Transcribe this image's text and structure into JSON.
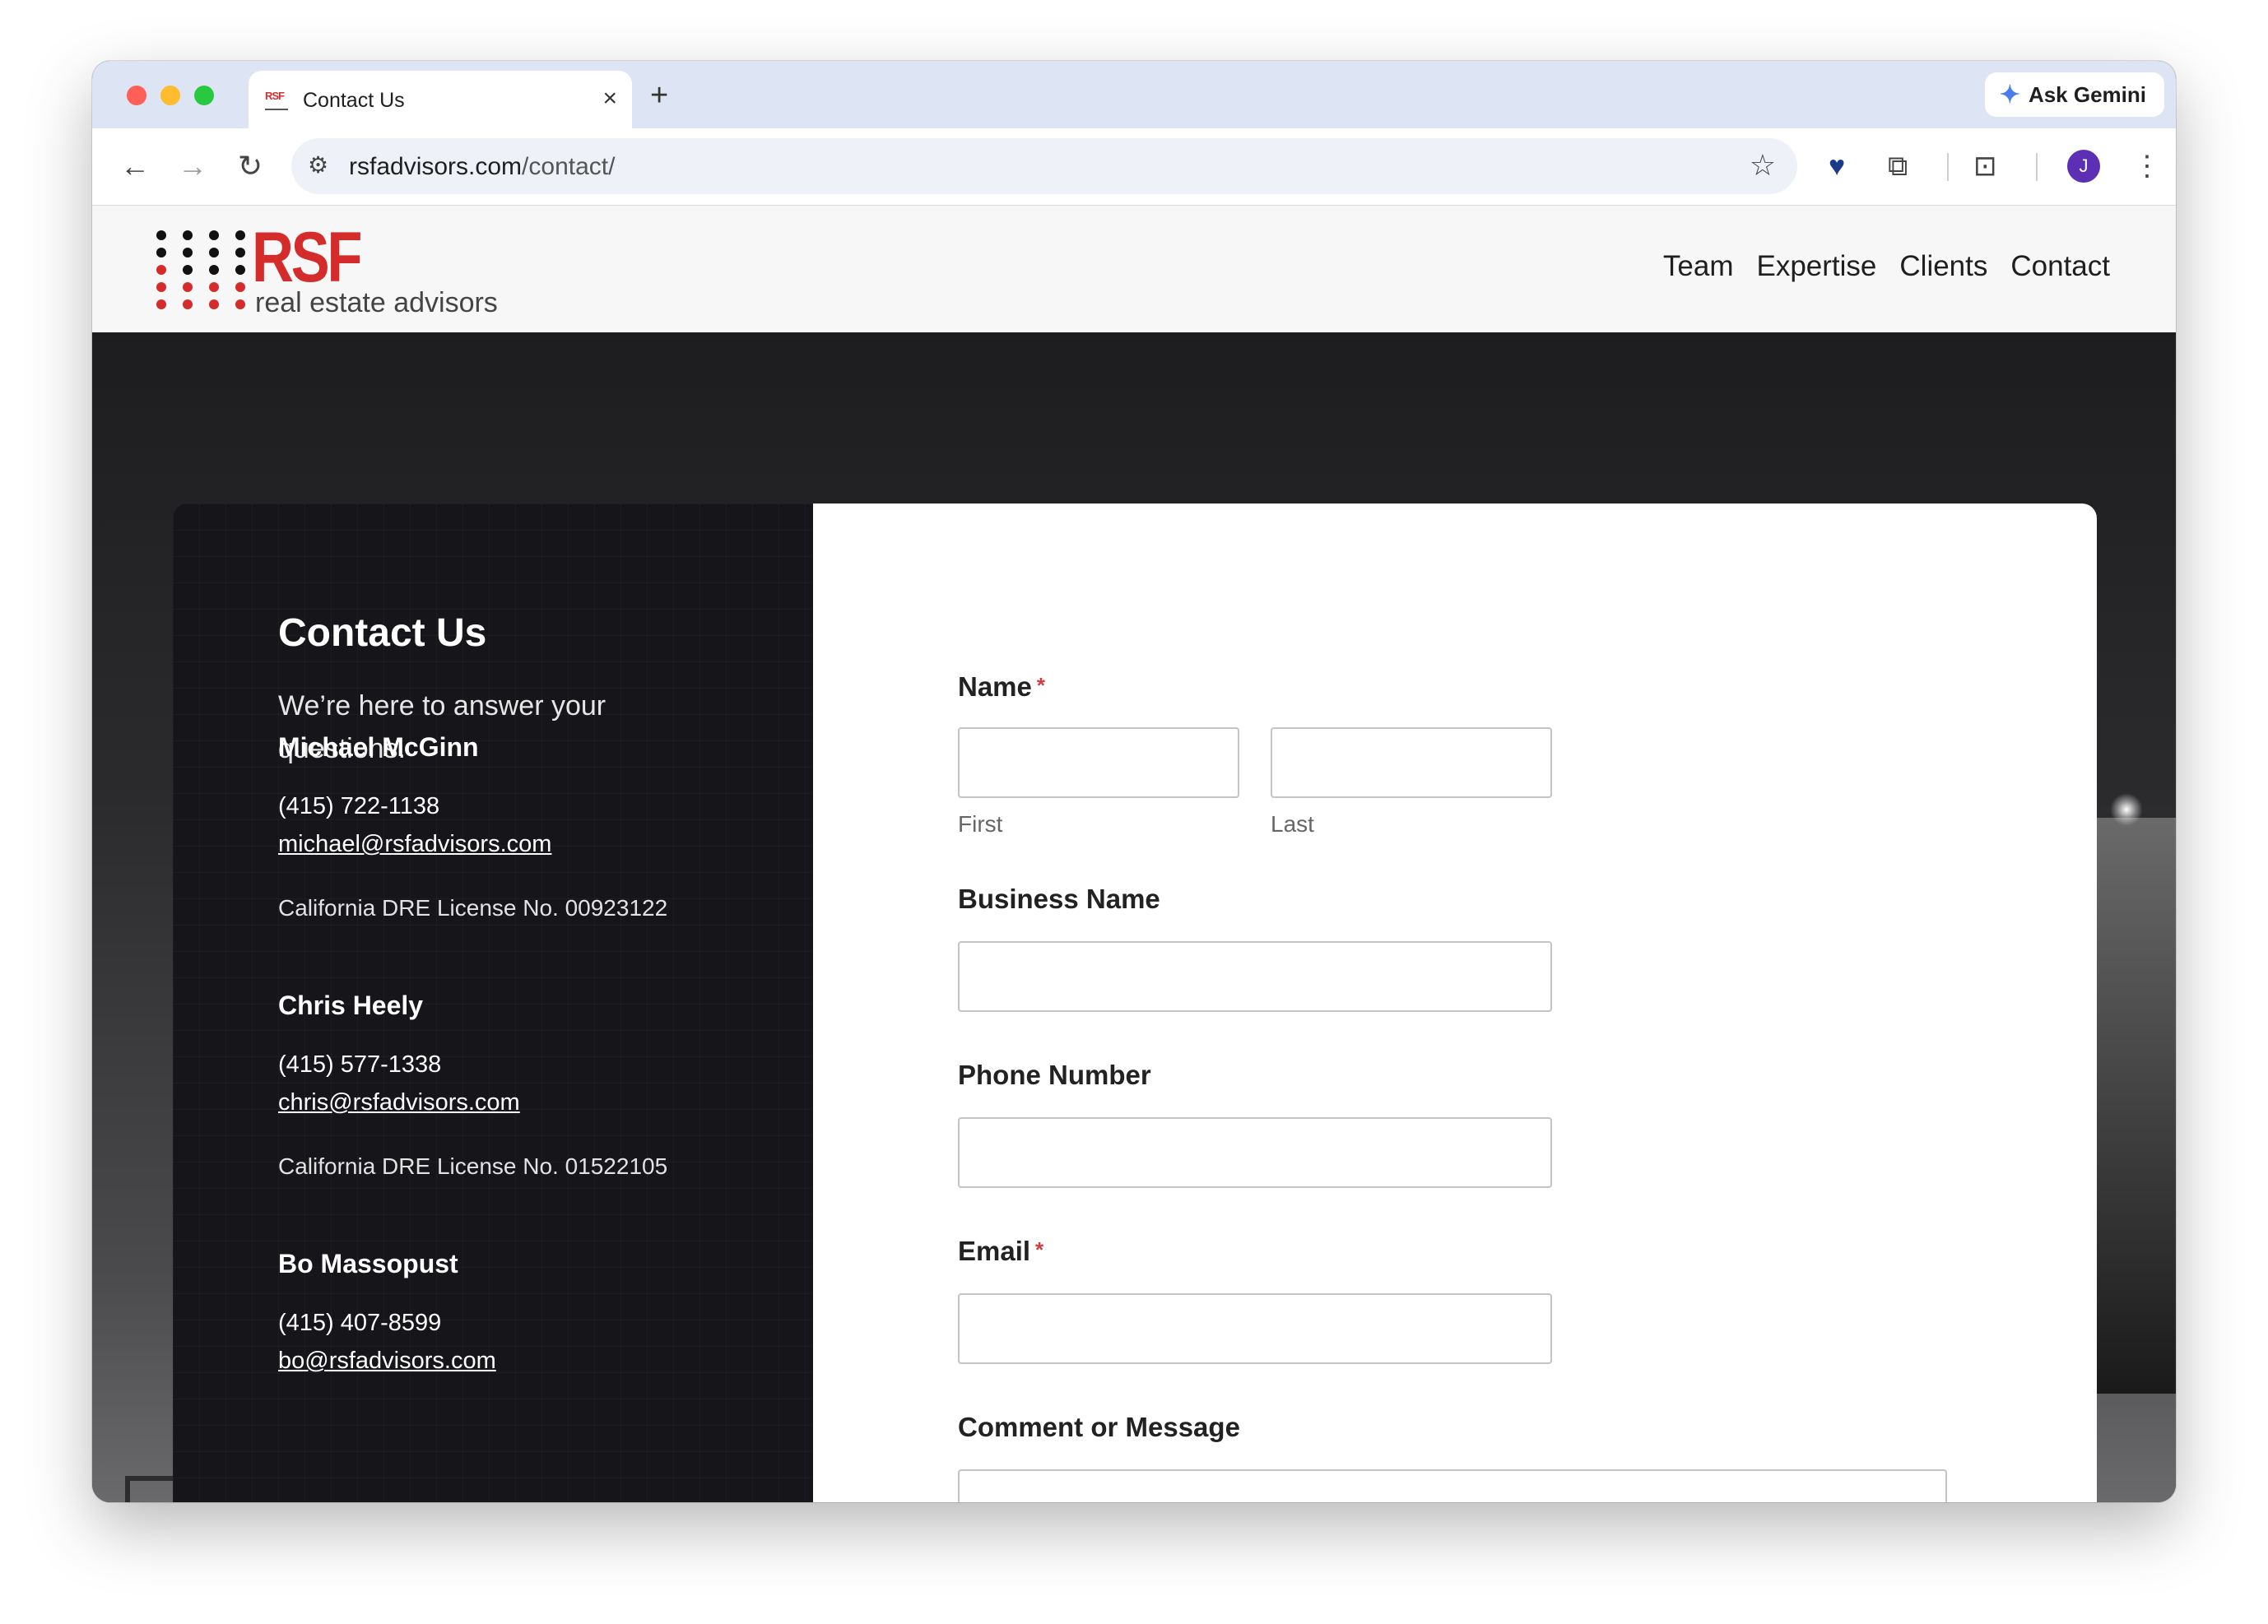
{
  "browser": {
    "tab_title": "Contact Us",
    "tab_favicon": "RSF",
    "new_tab": "+",
    "tab_close": "×",
    "gemini_label": "Ask Gemini",
    "url_host": "rsfadvisors.com",
    "url_path": "/contact/",
    "avatar_initial": "J"
  },
  "site": {
    "logo_text": "RSF",
    "logo_tagline": "real estate advisors",
    "nav": [
      "Team",
      "Expertise",
      "Clients",
      "Contact"
    ]
  },
  "contact": {
    "title": "Contact Us",
    "subtitle": "We’re here to answer your questions.",
    "people": [
      {
        "name": "Michael McGinn",
        "phone": "(415) 722-1138",
        "email": "michael@rsfadvisors.com",
        "license": "California DRE License No. 00923122"
      },
      {
        "name": "Chris Heely",
        "phone": "(415) 577-1338",
        "email": "chris@rsfadvisors.com",
        "license": "California DRE License No. 01522105"
      },
      {
        "name": "Bo Massopust",
        "phone": "(415) 407-8599",
        "email": "bo@rsfadvisors.com"
      }
    ]
  },
  "form": {
    "name_label": "Name",
    "required_mark": "*",
    "first_sublabel": "First",
    "last_sublabel": "Last",
    "business_label": "Business Name",
    "phone_label": "Phone Number",
    "email_label": "Email",
    "message_label": "Comment or Message",
    "first_value": "",
    "last_value": "",
    "business_value": "",
    "phone_value": "",
    "email_value": ""
  },
  "colors": {
    "brand_red": "#d42b2b",
    "required_red": "#d43b3b",
    "panel_dark": "#15151a"
  }
}
